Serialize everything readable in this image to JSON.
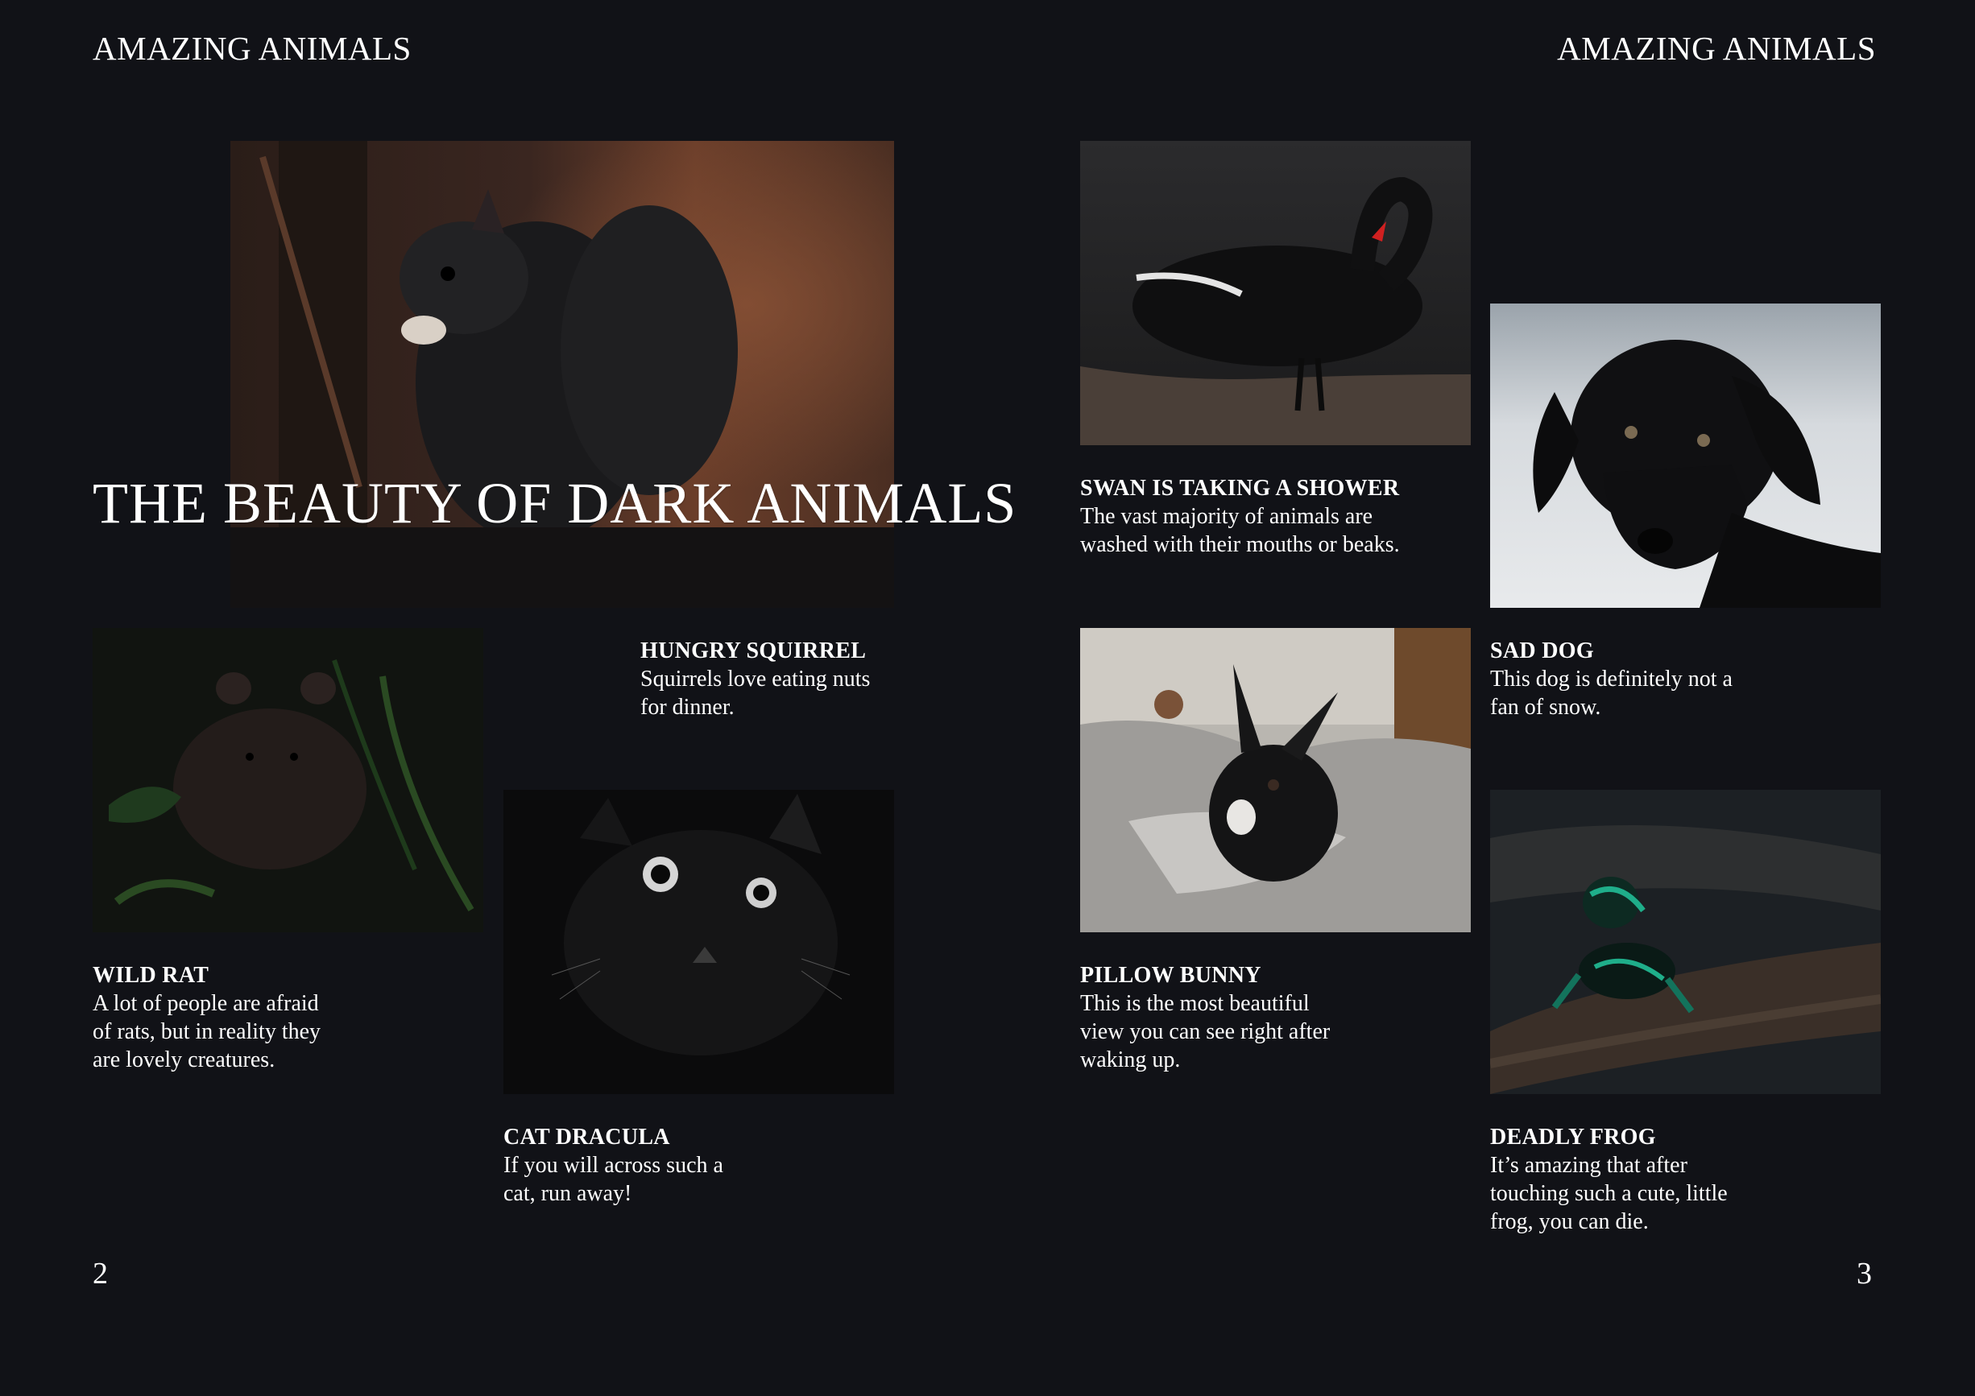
{
  "header": {
    "left": "AMAZING ANIMALS",
    "right": "AMAZING ANIMALS"
  },
  "title": "THE BEAUTY OF DARK ANIMALS",
  "page_numbers": {
    "left": "2",
    "right": "3"
  },
  "captions": {
    "squirrel": {
      "title": "HUNGRY SQUIRREL",
      "text": "Squirrels love eating nuts\nfor dinner."
    },
    "rat": {
      "title": "WILD RAT",
      "text": "A lot of people are afraid\nof rats, but in reality they\nare lovely creatures."
    },
    "cat": {
      "title": "CAT DRACULA",
      "text": "If you will across such a\ncat, run away!"
    },
    "swan": {
      "title": "SWAN IS TAKING A SHOWER",
      "text": "The vast majority of animals are\nwashed with their mouths or beaks."
    },
    "dog": {
      "title": "SAD DOG",
      "text": "This dog is definitely not a\nfan of snow."
    },
    "bunny": {
      "title": "PILLOW BUNNY",
      "text": "This is the most beautiful\nview you can see right after\nwaking up."
    },
    "frog": {
      "title": "DEADLY FROG",
      "text": "It’s amazing that after\ntouching such a cute, little\nfrog, you can die."
    }
  },
  "colors": {
    "background": "#111217",
    "text": "#ffffff"
  }
}
